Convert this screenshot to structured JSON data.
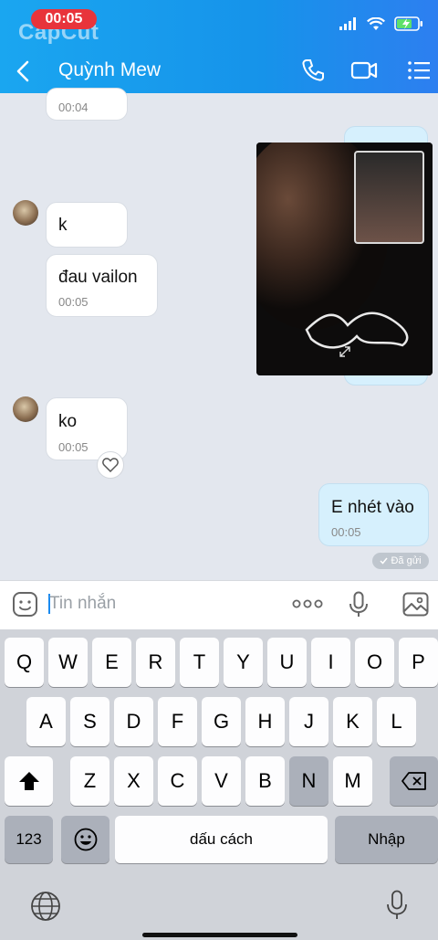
{
  "status": {
    "recording_time": "00:05",
    "watermark": "CapCut"
  },
  "header": {
    "title": "Quỳnh Mew"
  },
  "messages": {
    "top_partial_time": "00:04",
    "m1_text": "k",
    "m2_text": "đau vailon",
    "m2_time": "00:05",
    "m3_text": "ko",
    "m3_time": "00:05",
    "out_text": "E nhét vào",
    "out_time": "00:05",
    "sent_status": "Đã gửi"
  },
  "input": {
    "placeholder": "Tin nhắn"
  },
  "keyboard": {
    "row1": [
      "Q",
      "W",
      "E",
      "R",
      "T",
      "Y",
      "U",
      "I",
      "O",
      "P"
    ],
    "row2": [
      "A",
      "S",
      "D",
      "F",
      "G",
      "H",
      "J",
      "K",
      "L"
    ],
    "row3": [
      "Z",
      "X",
      "C",
      "V",
      "B",
      "N",
      "M"
    ],
    "numbers_label": "123",
    "space_label": "dấu cách",
    "return_label": "Nhập"
  },
  "colors": {
    "header": "#1693ea",
    "incoming": "#ffffff",
    "outgoing": "#d6f0fd",
    "accent": "#1a8bf0"
  }
}
